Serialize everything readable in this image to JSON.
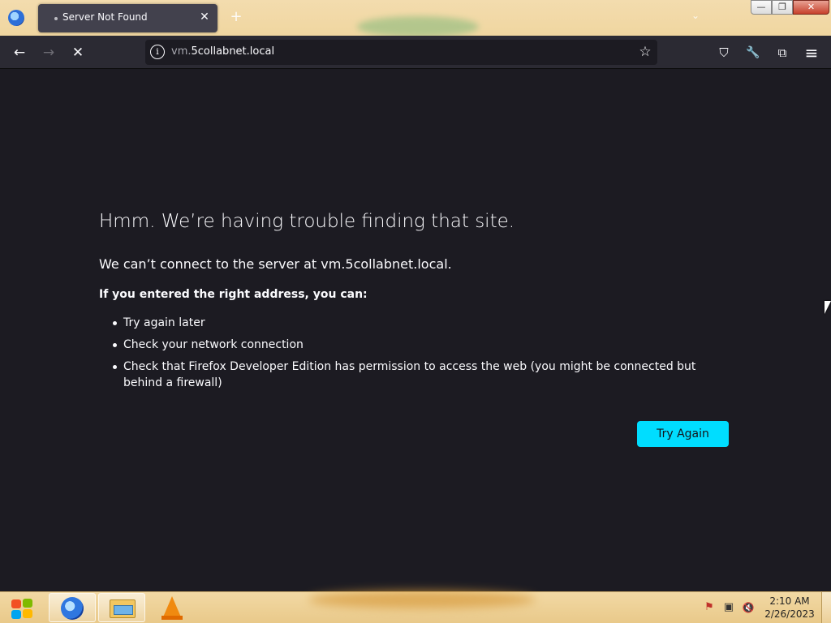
{
  "browser": {
    "tab": {
      "title": "Server Not Found",
      "close_glyph": "✕"
    },
    "new_tab_glyph": "+",
    "list_tabs_glyph": "⌄",
    "window_controls": {
      "minimize": "—",
      "maximize": "❐",
      "close": "✕"
    },
    "nav": {
      "back_glyph": "←",
      "forward_glyph": "→",
      "stop_glyph": "✕"
    },
    "urlbar": {
      "url_sub": "vm.",
      "url_domain": "5collabnet.local",
      "info_glyph": "i",
      "bookmark_glyph": "☆"
    },
    "toolbar_icons": [
      "pocket-icon",
      "wrench-icon",
      "extensions-icon",
      "menu-icon"
    ],
    "toolbar_glyphs": {
      "pocket": "⛉",
      "wrench": "🔧",
      "extensions": "⧉",
      "menu": "≡"
    }
  },
  "error_page": {
    "title": "Hmm. We’re having trouble finding that site.",
    "short_desc": "We can’t connect to the server at vm.5collabnet.local.",
    "intro": "If you entered the right address, you can:",
    "suggestions": [
      "Try again later",
      "Check your network connection",
      "Check that Firefox Developer Edition has permission to access the web (you might be connected but behind a firewall)"
    ],
    "try_again_label": "Try Again"
  },
  "taskbar": {
    "clock_time": "2:10 AM",
    "clock_date": "2/26/2023",
    "tray_glyphs": {
      "action_center": "⚑",
      "network": "▣",
      "volume": "🔇"
    }
  },
  "colors": {
    "accent": "#00ddff",
    "page_bg": "#1c1b22",
    "toolbar_bg": "#2b2a33"
  }
}
